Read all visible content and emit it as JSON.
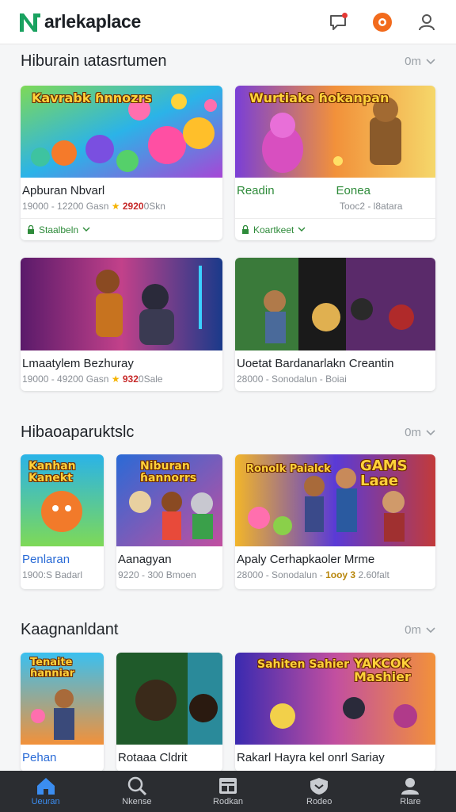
{
  "header": {
    "logo_text": "arlekaplace",
    "icons": [
      "chat-icon",
      "orange-record-icon",
      "user-icon"
    ]
  },
  "sections": [
    {
      "title": "Hiburain ɩatasrtumen",
      "more": "0m",
      "cards": [
        {
          "caption": "Kavrabk ɦnnozrs",
          "title": "Apburan Nbvarl",
          "meta_left": "19000 - 12200 Gasn",
          "meta_rating": "2920",
          "meta_right": "0Skn",
          "chip": "Staalbeln"
        },
        {
          "caption": "Wurtiake ɦokanpan",
          "title_left": "Readin",
          "title_right": "Eonea",
          "meta": "Tooc2 - l8atara",
          "chip": "Koartkeet"
        }
      ]
    },
    {
      "cards": [
        {
          "title": "Lmaatylem Bezhuray",
          "meta_left": "19000 - 49200 Gasn",
          "meta_rating": "932",
          "meta_right": "0Sale"
        },
        {
          "title": "Uoetat Bardanarlakn Creantin",
          "meta": "28000 - Sonodalun - Boiai"
        }
      ]
    },
    {
      "title": "Hibaoaparuktslc",
      "more": "0m",
      "cards": [
        {
          "caption": "Kanhan Kanekt",
          "title": "Penlaran",
          "meta": "1900:S Badarl"
        },
        {
          "caption": "Niburan ɦannorrs",
          "title": "Aanagyan",
          "meta": "9220 - 300 Bmoen"
        },
        {
          "caption_left": "Ronolk Paialck",
          "caption_right": "GAMS Laae",
          "title": "Apaly Cerhapkaoler Mrme",
          "meta_left": "28000 - Sonodalun -",
          "meta_hot": "1ooy 3",
          "meta_right": "2.60falt"
        }
      ]
    },
    {
      "title": "Kaagnanldant",
      "more": "0m",
      "cards": [
        {
          "caption": "Tenaite ɦanniar",
          "title": "Pehan"
        },
        {
          "title": "Rotaaa Cldrit"
        },
        {
          "caption_left": "Sahiten Sahier",
          "caption_right": "YAKCOK Mashier",
          "title": "Rakarl Hayra kel onrl Sariay"
        }
      ]
    }
  ],
  "bottom_nav": [
    {
      "label": "Ueuran",
      "icon": "home-icon",
      "active": true
    },
    {
      "label": "Nkense",
      "icon": "search-icon"
    },
    {
      "label": "Rodkan",
      "icon": "grid-icon"
    },
    {
      "label": "Rodeo",
      "icon": "shield-icon"
    },
    {
      "label": "Rlare",
      "icon": "profile-icon"
    }
  ],
  "colors": {
    "accent": "#3b8df0",
    "green": "#2e8b3a",
    "nav_bg": "#2b2d31"
  }
}
